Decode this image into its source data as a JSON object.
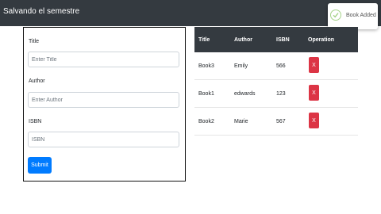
{
  "navbar": {
    "brand": "Salvando el semestre"
  },
  "toast": {
    "message": "Book Added",
    "icon": "check-circle-icon",
    "icon_color": "#a6d38a"
  },
  "form": {
    "title_label": "Title",
    "title_placeholder": "Enter Title",
    "author_label": "Author",
    "author_placeholder": "Enter Author",
    "isbn_label": "ISBN",
    "isbn_placeholder": "ISBN",
    "submit_label": "Submit"
  },
  "table": {
    "headers": [
      "Title",
      "Author",
      "ISBN",
      "Operation"
    ],
    "rows": [
      {
        "title": "Book3",
        "author": "Emily",
        "isbn": "566",
        "action": "X"
      },
      {
        "title": "Book1",
        "author": "edwards",
        "isbn": "123",
        "action": "X"
      },
      {
        "title": "Book2",
        "author": "Marie",
        "isbn": "567",
        "action": "X"
      }
    ]
  },
  "colors": {
    "navbar": "#343a40",
    "primary": "#007bff",
    "danger": "#dc3545"
  }
}
